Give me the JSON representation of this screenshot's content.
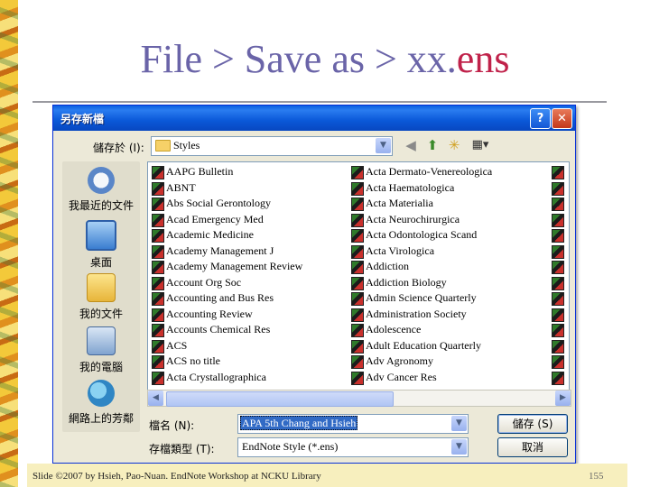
{
  "slide": {
    "title_main": "File > Save as > xx.",
    "title_ext": "ens",
    "footer": "Slide ©2007 by Hsieh, Pao-Nuan. EndNote Workshop at NCKU Library",
    "page_number": "155"
  },
  "dialog": {
    "title": "另存新檔",
    "help_glyph": "?",
    "close_glyph": "✕",
    "save_in_label": "儲存於 (I):",
    "save_in_value": "Styles",
    "dropdown_glyph": "▼",
    "toolbar": {
      "back_glyph": "◀",
      "up_glyph": "⬆",
      "new_folder_glyph": "✳",
      "view_glyph": "▦▾"
    },
    "places": [
      {
        "label": "我最近的文件",
        "icon": "recent-documents-icon"
      },
      {
        "label": "桌面",
        "icon": "desktop-icon"
      },
      {
        "label": "我的文件",
        "icon": "my-documents-icon"
      },
      {
        "label": "我的電腦",
        "icon": "my-computer-icon"
      },
      {
        "label": "網路上的芳鄰",
        "icon": "network-places-icon"
      }
    ],
    "files_col1": [
      "AAPG Bulletin",
      "ABNT",
      "Abs Social Gerontology",
      "Acad Emergency Med",
      "Academic Medicine",
      "Academy Management J",
      "Academy Management Review",
      "Account Org Soc",
      "Accounting and Bus Res",
      "Accounting Review",
      "Accounts Chemical Res",
      "ACS",
      "ACS no title",
      "Acta Crystallographica"
    ],
    "files_col2": [
      "Acta Dermato-Venereologica",
      "Acta Haematologica",
      "Acta Materialia",
      "Acta Neurochirurgica",
      "Acta Odontologica Scand",
      "Acta Virologica",
      "Addiction",
      "Addiction Biology",
      "Admin Science Quarterly",
      "Administration Society",
      "Adolescence",
      "Adult Education Quarterly",
      "Adv Agronomy",
      "Adv Cancer Res"
    ],
    "scroll_left_glyph": "◀",
    "scroll_right_glyph": "▶",
    "filename_label": "檔名 (N):",
    "filename_value": "APA 5th Chang and Hsieh",
    "filetype_label": "存檔類型 (T):",
    "filetype_value": "EndNote Style (*.ens)",
    "save_button": "儲存 (S)",
    "cancel_button": "取消"
  }
}
